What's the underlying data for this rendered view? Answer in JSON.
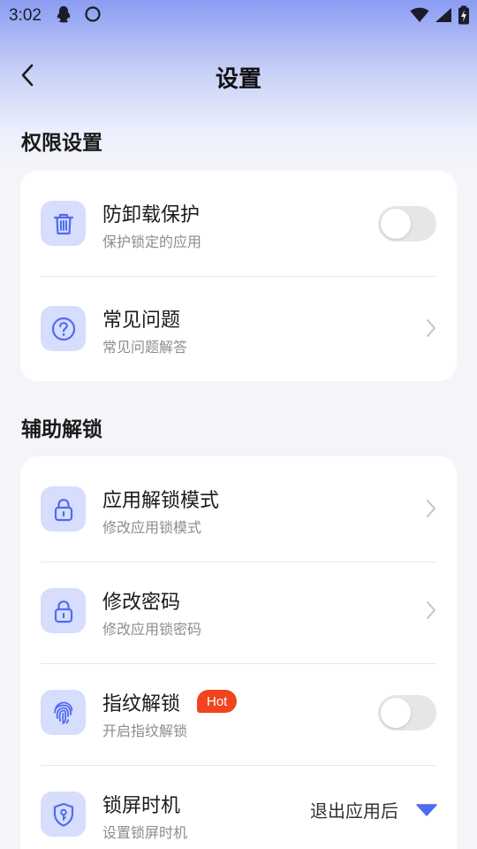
{
  "status_bar": {
    "time": "3:02",
    "left_icons": [
      "qq-penguin-icon",
      "circle-icon"
    ],
    "right_icons": [
      "wifi-icon",
      "signal-icon",
      "battery-charging-icon"
    ]
  },
  "header": {
    "title": "设置",
    "back_icon": "chevron-left-icon"
  },
  "sections": [
    {
      "title": "权限设置",
      "items": [
        {
          "title": "防卸载保护",
          "subtitle": "保护锁定的应用",
          "icon": "trash-icon",
          "control": "toggle",
          "on": false
        },
        {
          "title": "常见问题",
          "subtitle": "常见问题解答",
          "icon": "question-icon",
          "control": "chevron"
        }
      ]
    },
    {
      "title": "辅助解锁",
      "items": [
        {
          "title": "应用解锁模式",
          "subtitle": "修改应用锁模式",
          "icon": "lock-icon",
          "control": "chevron"
        },
        {
          "title": "修改密码",
          "subtitle": "修改应用锁密码",
          "icon": "lock-icon",
          "control": "chevron"
        },
        {
          "title": "指纹解锁",
          "subtitle": "开启指纹解锁",
          "icon": "fingerprint-icon",
          "control": "toggle",
          "on": false,
          "badge": "Hot"
        },
        {
          "title": "锁屏时机",
          "subtitle": "设置锁屏时机",
          "icon": "shield-key-icon",
          "control": "select",
          "value": "退出应用后"
        }
      ]
    }
  ],
  "colors": {
    "accent": "#4f6bf0",
    "icon_bg": "#d6ddfd",
    "hot_badge": "#f0441e",
    "toggle_off": "#e6e6e8",
    "page_bg": "#f4f5f9"
  }
}
